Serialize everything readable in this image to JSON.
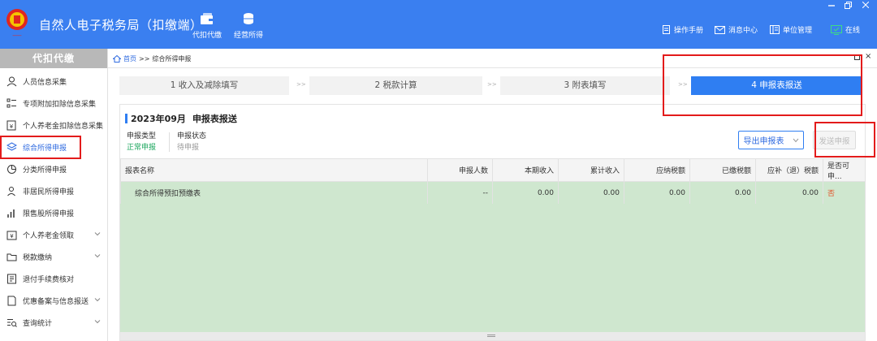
{
  "header": {
    "title": "自然人电子税务局（扣缴端）",
    "nav": [
      {
        "label": "代扣代缴",
        "icon": "wallet-icon"
      },
      {
        "label": "经营所得",
        "icon": "coins-icon"
      }
    ],
    "right": [
      {
        "label": "操作手册",
        "icon": "manual-icon"
      },
      {
        "label": "消息中心",
        "icon": "mail-icon"
      },
      {
        "label": "单位管理",
        "icon": "building-icon"
      },
      {
        "label": "在线",
        "icon": "online-monitor-icon"
      }
    ],
    "colors": {
      "bar": "#3a7ff0",
      "online": "#3ddc84"
    }
  },
  "sidebar": {
    "title": "代扣代缴",
    "items": [
      {
        "label": "人员信息采集",
        "icon": "person-icon"
      },
      {
        "label": "专项附加扣除信息采集",
        "icon": "list-icon"
      },
      {
        "label": "个人养老金扣除信息采集",
        "icon": "pension-icon"
      },
      {
        "label": "综合所得申报",
        "icon": "layers-icon",
        "active": true
      },
      {
        "label": "分类所得申报",
        "icon": "pie-icon"
      },
      {
        "label": "非居民所得申报",
        "icon": "person-outline-icon"
      },
      {
        "label": "限售股所得申报",
        "icon": "bar-chart-icon"
      },
      {
        "label": "个人养老金领取",
        "icon": "wallet-icon",
        "expandable": true
      },
      {
        "label": "税款缴纳",
        "icon": "folder-icon",
        "expandable": true
      },
      {
        "label": "退付手续费核对",
        "icon": "checklist-icon"
      },
      {
        "label": "优惠备案与信息报送",
        "icon": "document-icon",
        "expandable": true
      },
      {
        "label": "查询统计",
        "icon": "search-list-icon",
        "expandable": true
      }
    ]
  },
  "breadcrumb": {
    "home": "首页",
    "sep": ">>",
    "current": "综合所得申报"
  },
  "steps": [
    {
      "label": "1 收入及减除填写"
    },
    {
      "label": "2 税款计算"
    },
    {
      "label": "3 附表填写"
    },
    {
      "label": "4 申报表报送",
      "active": true
    }
  ],
  "step_separator": ">>",
  "panel": {
    "period": "2023年09月",
    "title": "申报表报送",
    "fields": [
      {
        "key": "申报类型",
        "value": "正常申报"
      },
      {
        "key": "申报状态",
        "value": "待申报"
      }
    ],
    "export_button": "导出申报表",
    "send_button": "发送申报"
  },
  "table": {
    "columns": [
      "报表名称",
      "申报人数",
      "本期收入",
      "累计收入",
      "应纳税额",
      "已缴税额",
      "应补（退）税额",
      "是否可申..."
    ],
    "rows": [
      {
        "name": "综合所得预扣预缴表",
        "count": "--",
        "income": "0.00",
        "cum_income": "0.00",
        "tax": "0.00",
        "paid": "0.00",
        "refund": "0.00",
        "can_declare": "否"
      }
    ]
  }
}
